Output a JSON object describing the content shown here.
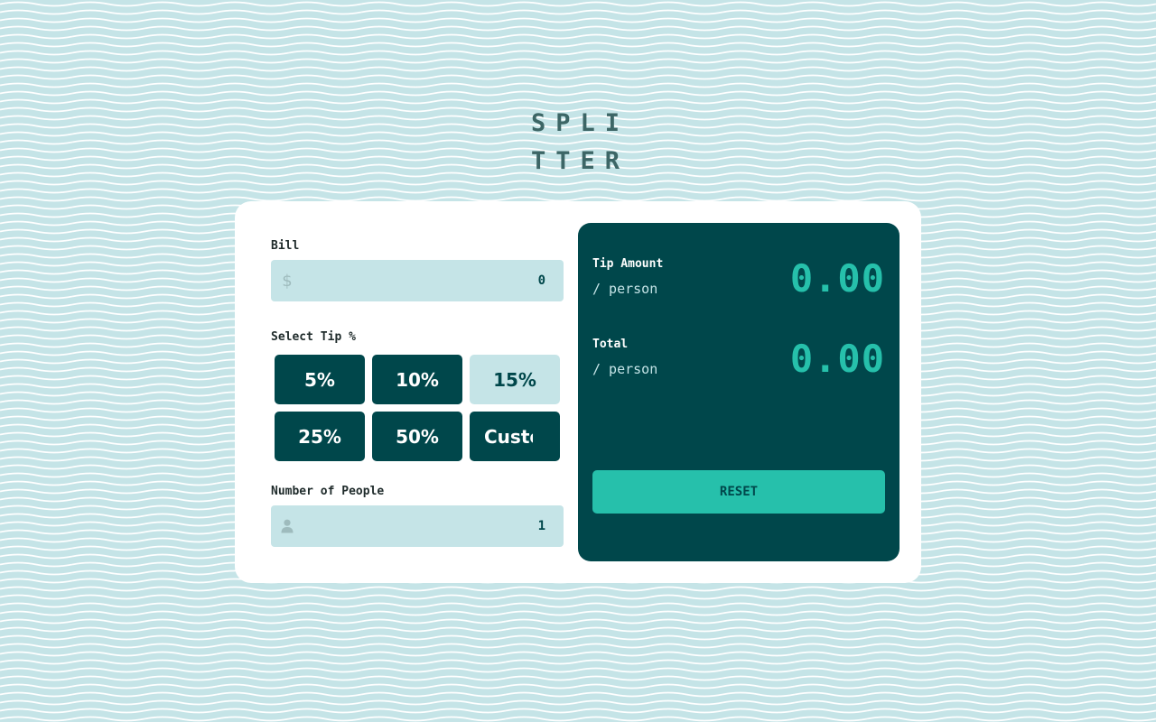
{
  "logo": {
    "line1": "SPLI",
    "line2": "TTER"
  },
  "bill": {
    "label": "Bill",
    "icon": "dollar-icon",
    "icon_glyph": "$",
    "value": "0"
  },
  "tip": {
    "label": "Select Tip %",
    "options": [
      {
        "label": "5%",
        "selected": false
      },
      {
        "label": "10%",
        "selected": false
      },
      {
        "label": "15%",
        "selected": true
      },
      {
        "label": "25%",
        "selected": false
      },
      {
        "label": "50%",
        "selected": false
      },
      {
        "label": "Custom",
        "selected": false
      }
    ]
  },
  "people": {
    "label": "Number of People",
    "icon": "person-icon",
    "value": "1"
  },
  "results": {
    "tip_amount": {
      "title": "Tip Amount",
      "sub": "/ person",
      "value": "0.00"
    },
    "total": {
      "title": "Total",
      "sub": "/ person",
      "value": "0.00"
    },
    "reset_label": "RESET"
  },
  "colors": {
    "background": "#c5e4e7",
    "dark_cyan": "#00474b",
    "accent_cyan": "#26c0ab",
    "light_cyan": "#c5e4e7",
    "logo": "#3d6666"
  }
}
